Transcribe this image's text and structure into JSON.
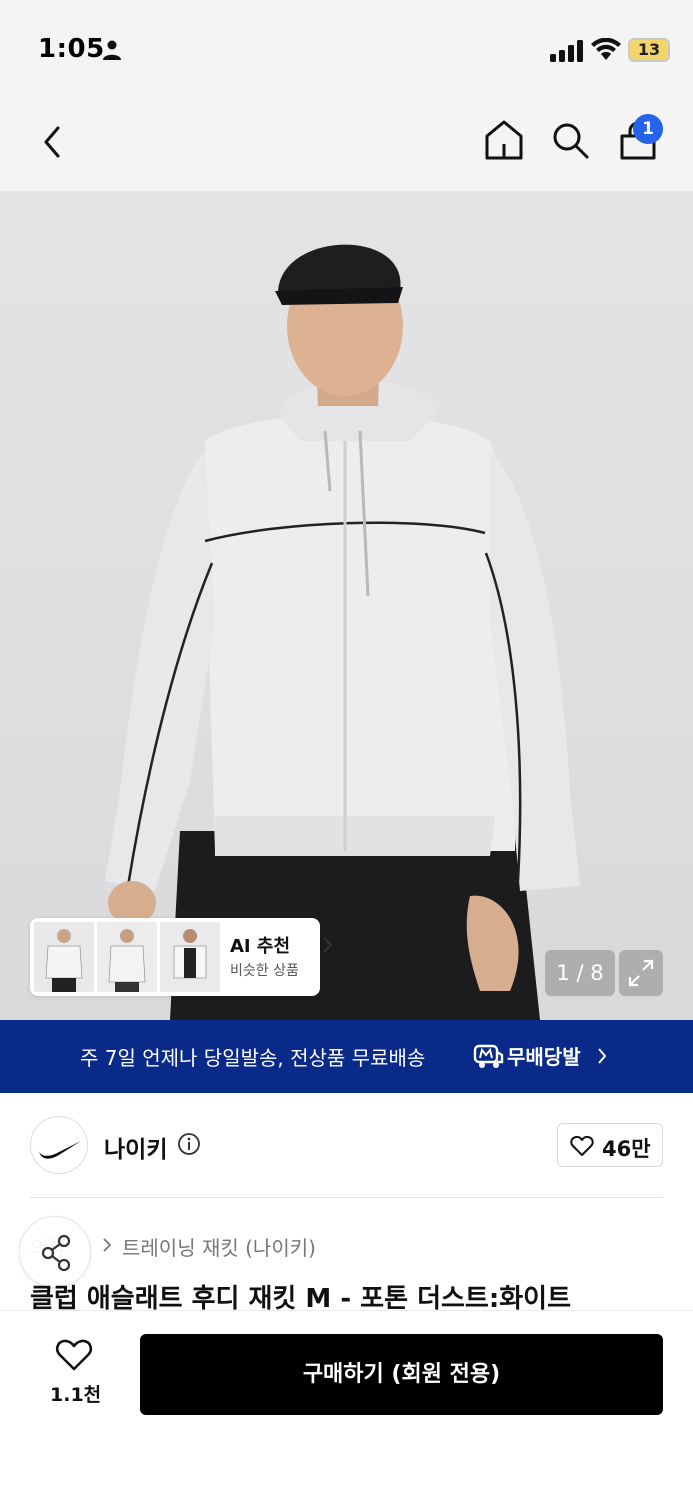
{
  "status_bar": {
    "time": "1:05",
    "battery": "13",
    "icons": [
      "person-icon",
      "signal-icon",
      "wifi-icon",
      "battery-icon"
    ]
  },
  "nav": {
    "icons": [
      "back-icon",
      "home-icon",
      "search-icon",
      "cart-icon"
    ],
    "cart_badge": "1"
  },
  "gallery": {
    "ai_recommend_title": "AI 추천",
    "ai_recommend_subtitle": "비슷한 상품",
    "page_indicator": "1 / 8",
    "expand_icon": "expand-icon"
  },
  "banner": {
    "text": "주 7일 언제나 당일발송, 전상품 무료배송",
    "brand": "무배당발"
  },
  "brand": {
    "name": "나이키",
    "like_count": "46만",
    "logo": "nike-swoosh-logo"
  },
  "breadcrumb": {
    "first": "의류",
    "second": "트레이닝 재킷 (나이키)"
  },
  "product": {
    "title": "클럽 애슬래트 후디 재킷 M - 포톤 더스트:화이트"
  },
  "bottom_bar": {
    "wish_count": "1.1천",
    "buy_label": "구매하기 (회원 전용)"
  },
  "colors": {
    "banner": "#0a2a8a",
    "badge": "#2563eb",
    "buy_button": "#000000"
  }
}
